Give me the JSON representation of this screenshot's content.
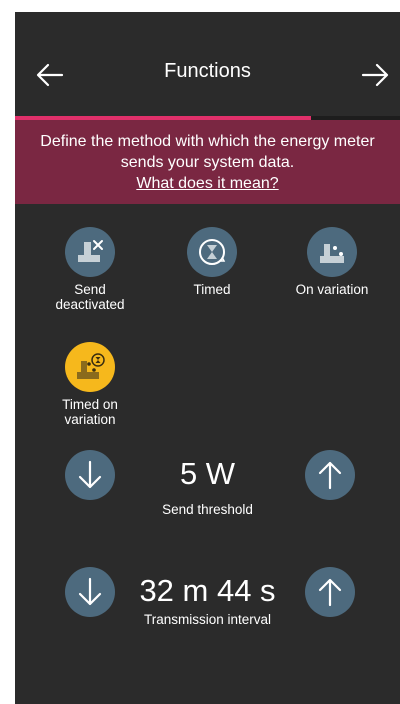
{
  "header": {
    "title": "Functions"
  },
  "progress": {
    "fraction": 0.77
  },
  "banner": {
    "description": "Define the method with which the energy meter sends your system data.",
    "link": "What does it mean?"
  },
  "modes": [
    {
      "label_line1": "Send",
      "label_line2": "deactivated",
      "icon": "send-deactivated-icon",
      "selected": false
    },
    {
      "label_line1": "Timed",
      "label_line2": "",
      "icon": "timer-icon",
      "selected": false
    },
    {
      "label_line1": "On variation",
      "label_line2": "",
      "icon": "on-variation-icon",
      "selected": false
    },
    {
      "label_line1": "Timed on",
      "label_line2": "variation",
      "icon": "timed-on-variation-icon",
      "selected": true
    }
  ],
  "threshold": {
    "value": "5 W",
    "label": "Send threshold"
  },
  "interval": {
    "value": "32 m 44 s",
    "label": "Transmission interval"
  },
  "colors": {
    "background": "#2b2b2b",
    "accent": "#e0306a",
    "banner": "#7a2742",
    "button": "#4d6a7e",
    "selected": "#f6b81c"
  }
}
